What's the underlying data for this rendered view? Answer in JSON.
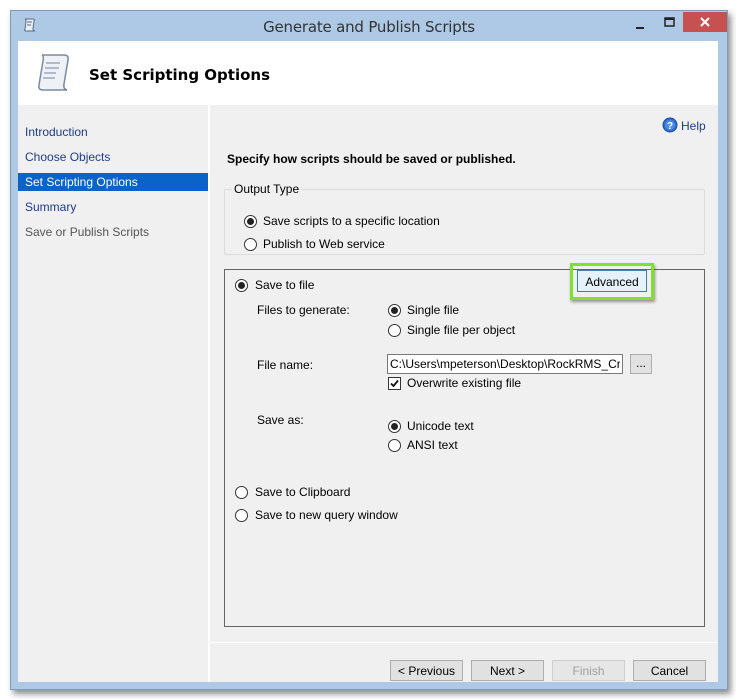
{
  "window": {
    "title": "Generate and Publish Scripts",
    "close_color": "#c75050",
    "frame_color": "#adc9e6"
  },
  "header": {
    "title": "Set Scripting Options",
    "icon": "script-scroll-icon"
  },
  "sidebar": {
    "items": [
      {
        "label": "Introduction",
        "state": "link"
      },
      {
        "label": "Choose Objects",
        "state": "link"
      },
      {
        "label": "Set Scripting Options",
        "state": "active"
      },
      {
        "label": "Summary",
        "state": "link"
      },
      {
        "label": "Save or Publish Scripts",
        "state": "disabled"
      }
    ],
    "active_color": "#0a63c8"
  },
  "main": {
    "help_label": "Help",
    "instruction": "Specify how scripts should be saved or published.",
    "output_type": {
      "legend": "Output Type",
      "options": [
        {
          "label": "Save scripts to a specific location",
          "checked": true
        },
        {
          "label": "Publish to Web service",
          "checked": false
        }
      ]
    },
    "save_to_file": {
      "label": "Save to file",
      "checked": true,
      "advanced_label": "Advanced",
      "highlight_color": "#7ee22a",
      "files_to_generate": {
        "label": "Files to generate:",
        "options": [
          {
            "label": "Single file",
            "checked": true
          },
          {
            "label": "Single file per object",
            "checked": false
          }
        ]
      },
      "file_name": {
        "label": "File name:",
        "value": "C:\\Users\\mpeterson\\Desktop\\RockRMS_Create",
        "browse_label": "..."
      },
      "overwrite": {
        "label": "Overwrite existing file",
        "checked": true
      },
      "save_as": {
        "label": "Save as:",
        "options": [
          {
            "label": "Unicode text",
            "checked": true
          },
          {
            "label": "ANSI text",
            "checked": false
          }
        ]
      }
    },
    "other_destinations": [
      {
        "label": "Save to Clipboard",
        "checked": false
      },
      {
        "label": "Save to new query window",
        "checked": false
      }
    ]
  },
  "footer": {
    "previous_label": "< Previous",
    "next_label": "Next >",
    "finish_label": "Finish",
    "finish_enabled": false,
    "cancel_label": "Cancel"
  }
}
